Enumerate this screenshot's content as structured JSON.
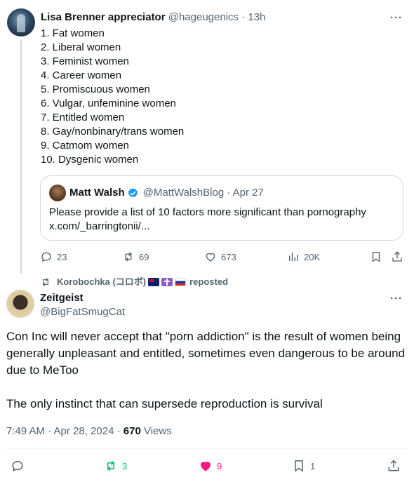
{
  "tweet1": {
    "author_name": "Lisa Brenner appreciator",
    "handle_meta": "@hageugenics · 13h",
    "list_items": [
      "1. Fat women",
      "2. Liberal women",
      "3. Feminist women",
      "4. Career women",
      "5. Promiscuous women",
      "6. Vulgar, unfeminine women",
      "7. Entitled women",
      "8. Gay/nonbinary/trans women",
      "9. Catmom women",
      "10. Dysgenic women"
    ],
    "quote": {
      "author_name": "Matt Walsh",
      "handle_meta": "@MattWalshBlog · Apr 27",
      "text": "Please provide a list of 10 factors more significant than pornography",
      "link": "x.com/_barringtonii/..."
    },
    "actions": {
      "replies": "23",
      "reposts": "69",
      "likes": "673",
      "views": "20K"
    }
  },
  "repost_indicator": {
    "user": "Korobochka (コロボ)",
    "suffix": "reposted"
  },
  "tweet2": {
    "author_name": "Zeitgeist",
    "handle": "@BigFatSmugCat",
    "paragraph1": "Con Inc will never accept that \"porn addiction\" is the result of women being generally unpleasant and entitled, sometimes even dangerous to be around due to MeToo",
    "paragraph2": "The only instinct that can supersede reproduction is survival",
    "timestamp": "7:49 AM · Apr 28, 2024 · ",
    "views_count": "670",
    "views_label": " Views",
    "actions": {
      "reposts": "3",
      "likes": "9",
      "bookmarks": "1"
    }
  },
  "colors": {
    "text_primary": "#0f1419",
    "text_secondary": "#536471",
    "border": "#cfd9de",
    "verified_blue": "#1d9bf0",
    "repost_green": "#00ba7c",
    "like_pink": "#f91880"
  },
  "icons": [
    "reply-icon",
    "repost-icon",
    "like-icon",
    "views-icon",
    "bookmark-icon",
    "share-icon",
    "more-icon",
    "verified-icon"
  ]
}
